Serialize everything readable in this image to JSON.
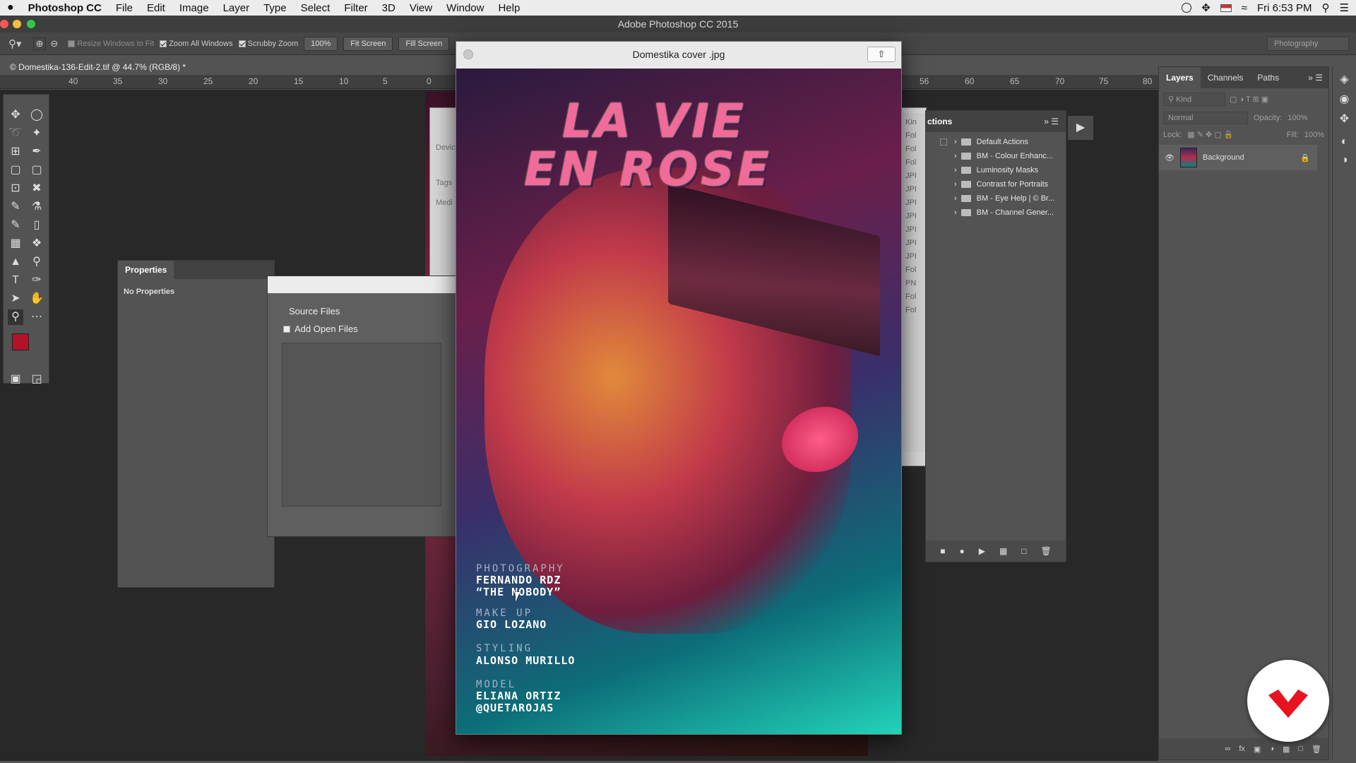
{
  "menubar": {
    "apple": "",
    "app": "Photoshop CC",
    "items": [
      "File",
      "Edit",
      "Image",
      "Layer",
      "Type",
      "Select",
      "Filter",
      "3D",
      "View",
      "Window",
      "Help"
    ],
    "clock": "Fri 6:53 PM"
  },
  "titlebar": {
    "title": "Adobe Photoshop CC 2015"
  },
  "options": {
    "resize": "Resize Windows to Fit",
    "zoom_all": "Zoom All Windows",
    "scrubby": "Scrubby Zoom",
    "zoom_value": "100%",
    "fit_screen": "Fit Screen",
    "fill_screen": "Fill Screen",
    "workspace": "Photography"
  },
  "document": {
    "tab": "© Domestika-136-Edit-2.tif @ 44.7% (RGB/8) *"
  },
  "ruler": {
    "left": [
      "40",
      "35",
      "30",
      "25",
      "20",
      "15",
      "10",
      "5",
      "0"
    ],
    "right": [
      "56",
      "60",
      "65",
      "70",
      "75",
      "80"
    ]
  },
  "properties": {
    "title": "Properties",
    "empty": "No Properties"
  },
  "bridge_dialog": {
    "source_files": "Source Files",
    "add_open_files": "Add Open Files",
    "side_labels": [
      "Devic",
      "Tags",
      "Medi"
    ]
  },
  "actions": {
    "title": "ctions",
    "items": [
      "Default Actions",
      "BM - Colour Enhanc...",
      "Luminosity Masks",
      "Contrast for Portraits",
      "BM - Eye Help | © Br...",
      "BM - Channel Gener..."
    ],
    "kind_header": "Kin",
    "kind_values": [
      "Fol",
      "Fol",
      "Fol",
      "JPI",
      "JPI",
      "JPI",
      "JPI",
      "JPI",
      "JPI",
      "JPI",
      "Fol",
      "PN",
      "Fol",
      "Fol"
    ]
  },
  "layers": {
    "tabs": [
      "Layers",
      "Channels",
      "Paths"
    ],
    "kind": "Kind",
    "blend": "Normal",
    "opacity_label": "Opacity:",
    "opacity_value": "100%",
    "lock_label": "Lock:",
    "fill_label": "Fill:",
    "fill_value": "100%",
    "layer_name": "Background"
  },
  "preview": {
    "filename": "Domestika cover .jpg",
    "title_line1": "LA VIE",
    "title_line2": "EN ROSE",
    "credits": [
      {
        "role": "PHOTOGRAPHY",
        "name1": "FERNANDO RDZ",
        "name2": "“THE NOBODY”"
      },
      {
        "role": "MAKE UP",
        "name1": "GIO LOZANO",
        "name2": ""
      },
      {
        "role": "STYLING",
        "name1": "ALONSO MURILLO",
        "name2": ""
      },
      {
        "role": "MODEL",
        "name1": "ELIANA ORTIZ",
        "name2": "@QUETAROJAS"
      }
    ]
  },
  "colors": {
    "foreground": "#b3122a",
    "background": "#ffffff",
    "accent_badge": "#e8131f"
  }
}
